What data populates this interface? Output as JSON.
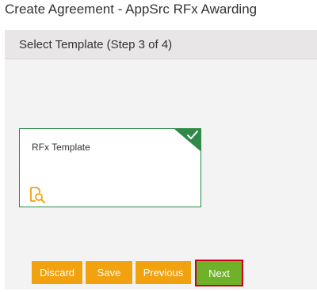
{
  "page": {
    "title": "Create Agreement - AppSrc RFx Awarding"
  },
  "panel": {
    "title": "Select Template (Step 3 of 4)"
  },
  "template_card": {
    "label": "RFx Template",
    "selected": true,
    "selected_icon": "checkmark-icon",
    "preview_icon": "document-search-icon"
  },
  "buttons": {
    "discard": "Discard",
    "save": "Save",
    "previous": "Previous",
    "next": "Next"
  },
  "colors": {
    "accent_orange": "#f2a10f",
    "next_green": "#6fb22a",
    "selected_green": "#2e8a46",
    "highlight_red": "#d0021b"
  }
}
